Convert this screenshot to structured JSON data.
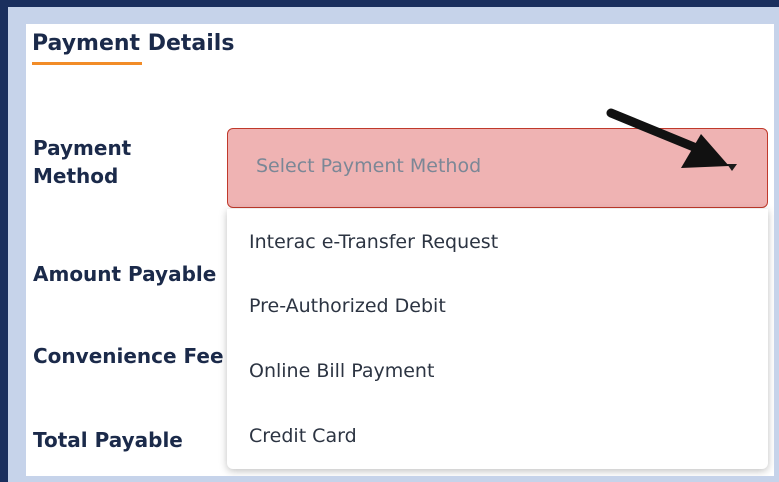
{
  "payment": {
    "title": "Payment Details",
    "labels": {
      "method": "Payment Method",
      "amount": "Amount Payable",
      "fee": "Convenience Fee",
      "total": "Total Payable"
    },
    "select": {
      "placeholder": "Select Payment Method",
      "options": [
        "Interac e-Transfer Request",
        "Pre-Authorized Debit",
        "Online Bill Payment",
        "Credit Card"
      ]
    },
    "colors": {
      "accent_underline": "#f28c28",
      "select_error_bg": "#efb3b3",
      "select_error_border": "#c0392b",
      "outer_bg": "#1a2f5e",
      "frame_bg": "#c6d3ea"
    },
    "annotation_icon": "black-pointer-arrow"
  }
}
